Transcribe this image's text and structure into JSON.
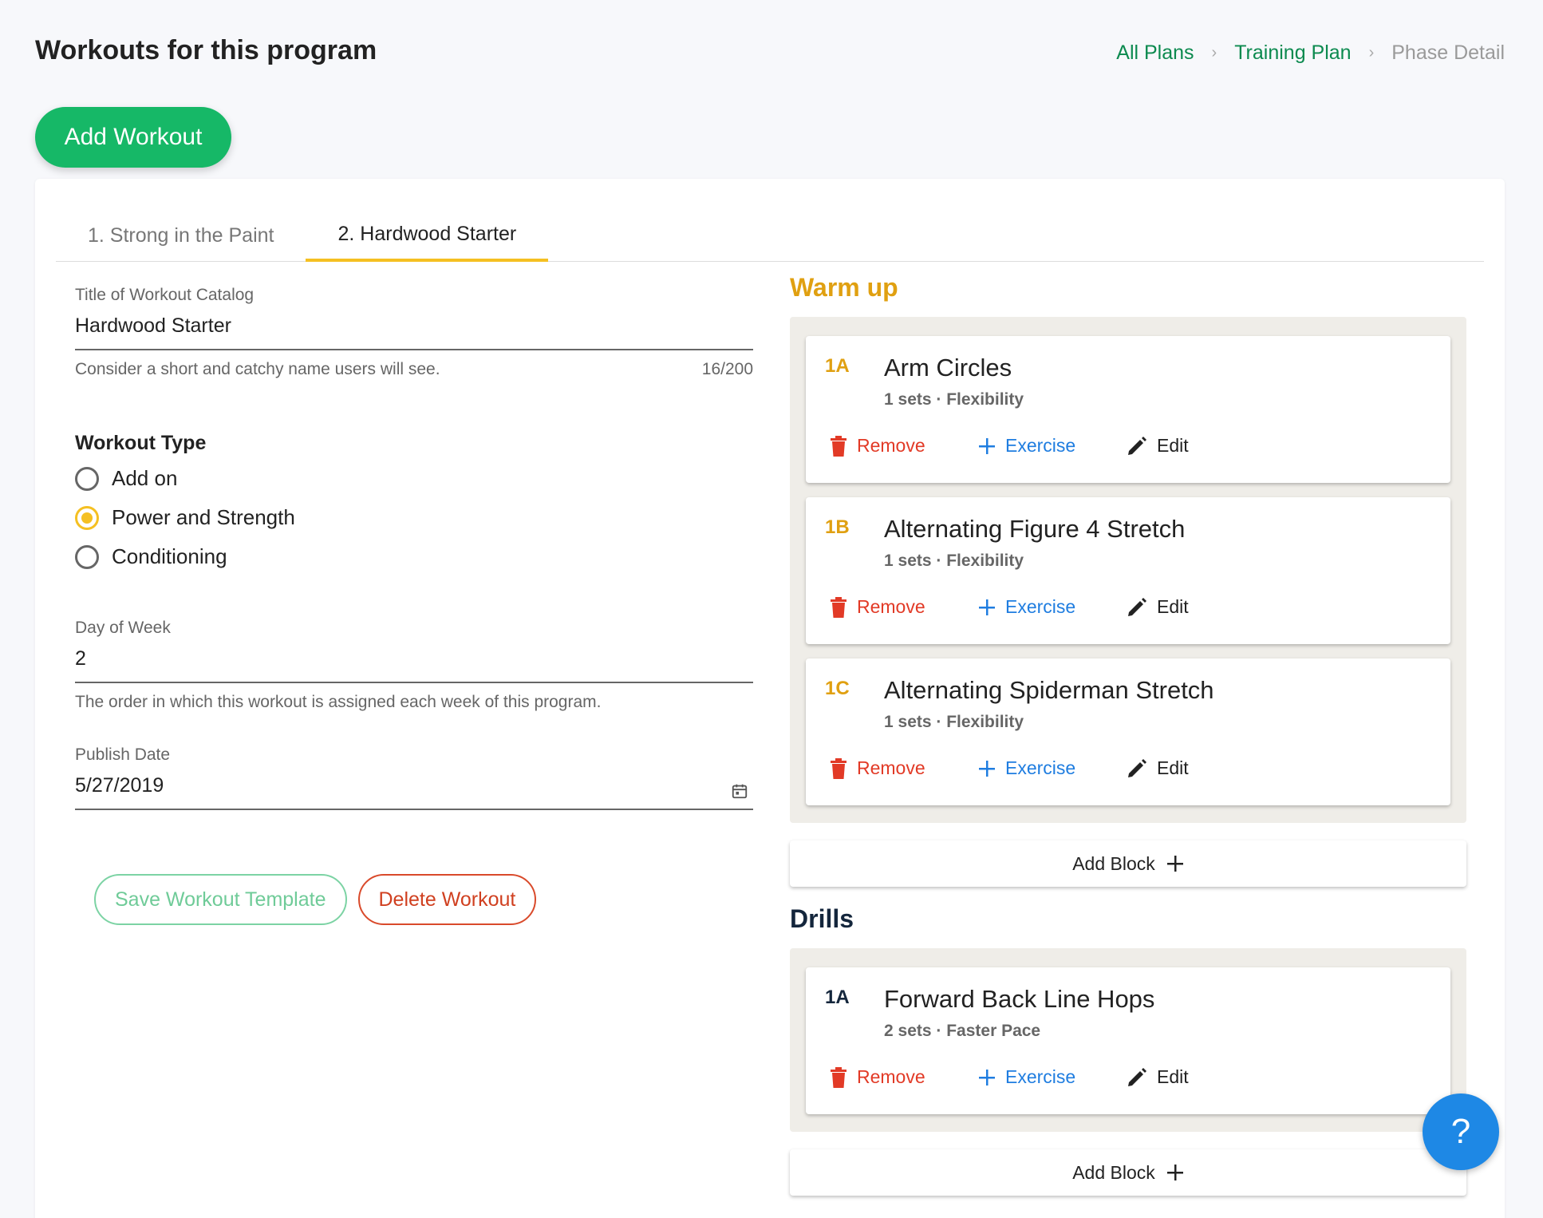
{
  "header": {
    "title": "Workouts for this program",
    "breadcrumb": [
      "All Plans",
      "Training Plan",
      "Phase Detail"
    ]
  },
  "add_workout_label": "Add Workout",
  "tabs": [
    "1. Strong in the Paint",
    "2. Hardwood Starter"
  ],
  "form": {
    "title_label": "Title of Workout Catalog",
    "title_value": "Hardwood Starter",
    "title_help": "Consider a short and catchy name users will see.",
    "title_counter": "16/200",
    "workout_type_label": "Workout Type",
    "workout_types": [
      "Add on",
      "Power and Strength",
      "Conditioning"
    ],
    "workout_type_selected": "Power and Strength",
    "day_label": "Day of Week",
    "day_value": "2",
    "day_help": "The order in which this workout is assigned each week of this program.",
    "publish_label": "Publish Date",
    "publish_value": "5/27/2019",
    "save_label": "Save Workout Template",
    "delete_label": "Delete Workout"
  },
  "actions": {
    "remove": "Remove",
    "exercise": "Exercise",
    "edit": "Edit",
    "add_block": "Add Block"
  },
  "blocks": {
    "warmup": {
      "title": "Warm up",
      "color": "#e0a011",
      "exercises": [
        {
          "code": "1A",
          "name": "Arm Circles",
          "meta": "1 sets · Flexibility"
        },
        {
          "code": "1B",
          "name": "Alternating Figure 4 Stretch",
          "meta": "1 sets · Flexibility"
        },
        {
          "code": "1C",
          "name": "Alternating Spiderman Stretch",
          "meta": "1 sets · Flexibility"
        }
      ]
    },
    "drills": {
      "title": "Drills",
      "color": "#14263c",
      "exercises": [
        {
          "code": "1A",
          "name": "Forward Back Line Hops",
          "meta": "2 sets · Faster Pace"
        }
      ]
    }
  },
  "help_label": "?",
  "colors": {
    "brand_green": "#16b867",
    "link_green": "#0c8a4f",
    "accent_yellow": "#f5c022",
    "remove_red": "#e23a26",
    "exercise_blue": "#1f7de0",
    "help_blue": "#1e88e5"
  }
}
